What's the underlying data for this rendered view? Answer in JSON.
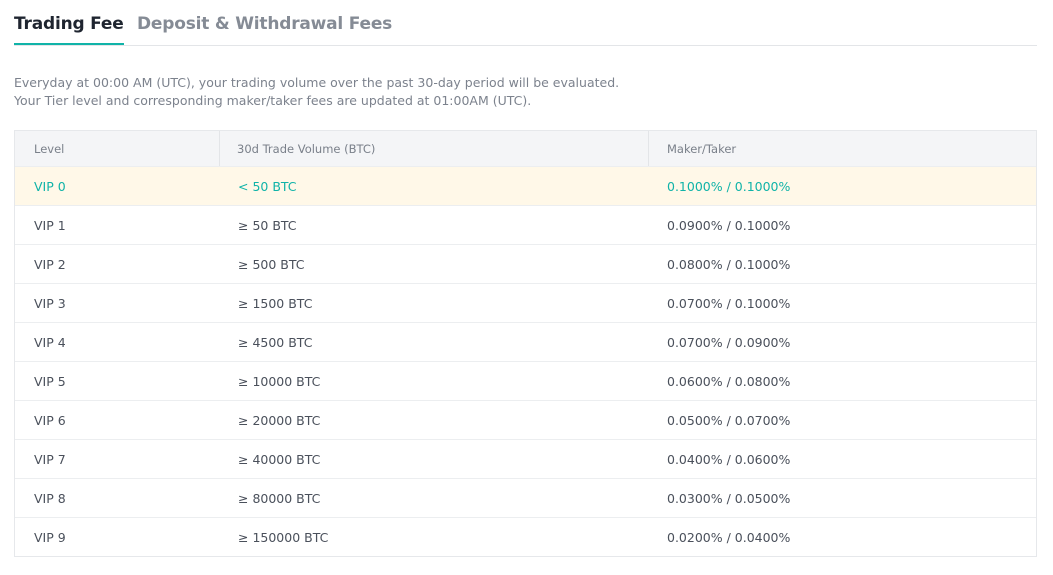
{
  "tabs": [
    {
      "label": "Trading Fee",
      "active": true
    },
    {
      "label": "Deposit & Withdrawal Fees",
      "active": false
    }
  ],
  "description": {
    "line1": "Everyday at 00:00 AM (UTC), your trading volume over the past 30-day period will be evaluated.",
    "line2": "Your Tier level and corresponding maker/taker fees are updated at 01:00AM (UTC)."
  },
  "table": {
    "headers": [
      "Level",
      "30d Trade Volume (BTC)",
      "Maker/Taker"
    ],
    "rows": [
      {
        "level": "VIP 0",
        "volume": "< 50 BTC",
        "fee": "0.1000% / 0.1000%"
      },
      {
        "level": "VIP 1",
        "volume": "≥ 50 BTC",
        "fee": "0.0900% / 0.1000%"
      },
      {
        "level": "VIP 2",
        "volume": "≥ 500 BTC",
        "fee": "0.0800% / 0.1000%"
      },
      {
        "level": "VIP 3",
        "volume": "≥ 1500 BTC",
        "fee": "0.0700% / 0.1000%"
      },
      {
        "level": "VIP 4",
        "volume": "≥ 4500 BTC",
        "fee": "0.0700% / 0.0900%"
      },
      {
        "level": "VIP 5",
        "volume": "≥ 10000 BTC",
        "fee": "0.0600% / 0.0800%"
      },
      {
        "level": "VIP 6",
        "volume": "≥ 20000 BTC",
        "fee": "0.0500% / 0.0700%"
      },
      {
        "level": "VIP 7",
        "volume": "≥ 40000 BTC",
        "fee": "0.0400% / 0.0600%"
      },
      {
        "level": "VIP 8",
        "volume": "≥ 80000 BTC",
        "fee": "0.0300% / 0.0500%"
      },
      {
        "level": "VIP 9",
        "volume": "≥ 150000 BTC",
        "fee": "0.0200% / 0.0400%"
      }
    ]
  },
  "colors": {
    "accent": "#10b3a8",
    "current_row_bg": "#fff8e8"
  }
}
